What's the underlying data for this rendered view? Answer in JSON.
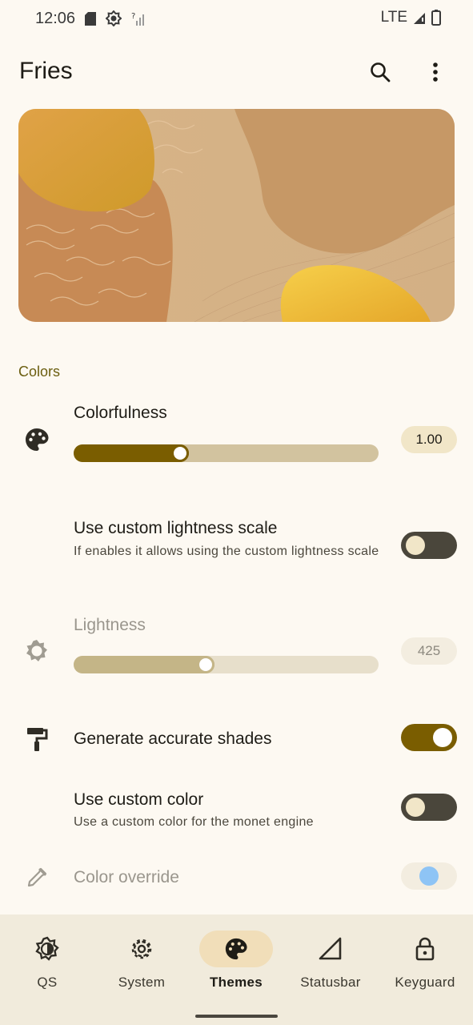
{
  "status_bar": {
    "time": "12:06",
    "network": "LTE"
  },
  "app_bar": {
    "title": "Fries"
  },
  "section": {
    "title": "Colors"
  },
  "colorfulness": {
    "label": "Colorfulness",
    "value_text": "1.00",
    "fraction": 0.34
  },
  "custom_lightness": {
    "label": "Use custom lightness scale",
    "description": "If enables it allows using the custom lightness scale",
    "enabled": false
  },
  "lightness": {
    "label": "Lightness",
    "value_text": "425",
    "fraction": 0.43
  },
  "accurate_shades": {
    "label": "Generate accurate shades",
    "enabled": true
  },
  "custom_color": {
    "label": "Use custom color",
    "description": "Use a custom color for the monet engine",
    "enabled": false
  },
  "color_override": {
    "label": "Color override",
    "color": "#8ec4f5"
  },
  "nav": {
    "active": "Themes",
    "items": [
      {
        "label": "QS",
        "icon": "qs-icon"
      },
      {
        "label": "System",
        "icon": "gear-icon"
      },
      {
        "label": "Themes",
        "icon": "palette-icon"
      },
      {
        "label": "Statusbar",
        "icon": "signal-icon"
      },
      {
        "label": "Keyguard",
        "icon": "lock-icon"
      }
    ]
  },
  "colors": {
    "accent": "#7a5d00",
    "accent_track": "#d2c39f",
    "switch_off": "#4a463b",
    "chip_bg": "#f1e6c8"
  }
}
